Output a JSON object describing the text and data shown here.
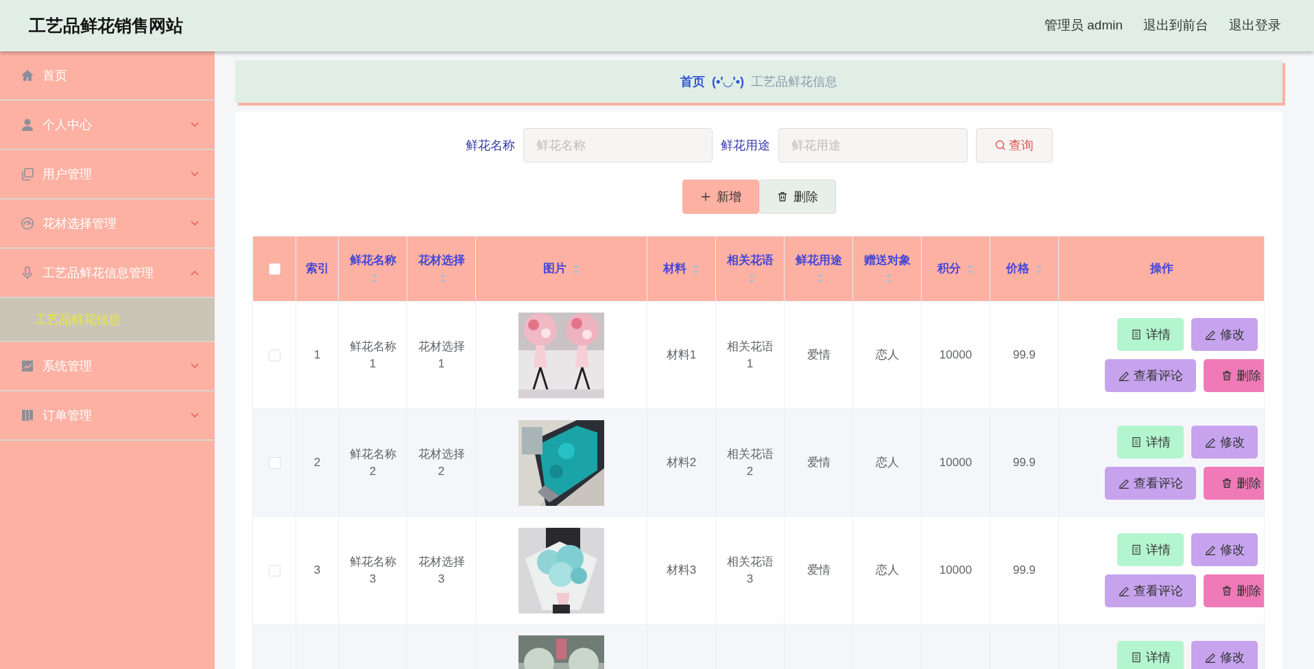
{
  "header": {
    "title": "工艺品鲜花销售网站",
    "links": [
      "管理员 admin",
      "退出到前台",
      "退出登录"
    ]
  },
  "sidebar": {
    "items": [
      {
        "label": "首页"
      },
      {
        "label": "个人中心",
        "expanded": false
      },
      {
        "label": "用户管理",
        "expanded": false
      },
      {
        "label": "花材选择管理",
        "expanded": false
      },
      {
        "label": "工艺品鲜花信息管理",
        "expanded": true,
        "children": [
          {
            "label": "工艺品鲜花信息",
            "selected": true
          }
        ]
      },
      {
        "label": "系统管理",
        "expanded": false
      },
      {
        "label": "订单管理",
        "expanded": false
      }
    ]
  },
  "breadcrumb": {
    "home": "首页",
    "emoticon": "(•'◡'•)",
    "current": "工艺品鲜花信息"
  },
  "search": {
    "fields": [
      {
        "label": "鲜花名称",
        "placeholder": "鲜花名称"
      },
      {
        "label": "鲜花用途",
        "placeholder": "鲜花用途"
      }
    ],
    "button": "查询"
  },
  "toolbar": [
    {
      "label": "新增",
      "kind": "add"
    },
    {
      "label": "删除",
      "kind": "delete"
    }
  ],
  "table": {
    "select_all": {
      "checked": false
    },
    "columns": [
      {
        "label": "索引",
        "sortable": false
      },
      {
        "label": "鲜花名称",
        "sortable": true
      },
      {
        "label": "花材选择",
        "sortable": true
      },
      {
        "label": "图片",
        "sortable": true
      },
      {
        "label": "材料",
        "sortable": true
      },
      {
        "label": "相关花语",
        "sortable": true
      },
      {
        "label": "鲜花用途",
        "sortable": true
      },
      {
        "label": "赠送对象",
        "sortable": true
      },
      {
        "label": "积分",
        "sortable": true
      },
      {
        "label": "价格",
        "sortable": true
      },
      {
        "label": "操作",
        "sortable": false
      }
    ],
    "rows": [
      {
        "checked": false,
        "cells": [
          "1",
          "鲜花名称1",
          "花材选择1",
          {
            "kind": "picture"
          },
          "材料1",
          "相关花语1",
          "爱情",
          "恋人",
          "10000",
          "99.9"
        ],
        "actions": [
          {
            "label": "详情",
            "kind": "detail"
          },
          {
            "label": "修改",
            "kind": "edit"
          },
          {
            "label": "查看评论",
            "kind": "comments"
          },
          {
            "label": "删除",
            "kind": "delete"
          }
        ]
      },
      {
        "checked": false,
        "cells": [
          "2",
          "鲜花名称2",
          "花材选择2",
          {
            "kind": "picture"
          },
          "材料2",
          "相关花语2",
          "爱情",
          "恋人",
          "10000",
          "99.9"
        ],
        "actions": [
          {
            "label": "详情",
            "kind": "detail"
          },
          {
            "label": "修改",
            "kind": "edit"
          },
          {
            "label": "查看评论",
            "kind": "comments"
          },
          {
            "label": "删除",
            "kind": "delete"
          }
        ]
      },
      {
        "checked": false,
        "cells": [
          "3",
          "鲜花名称3",
          "花材选择3",
          {
            "kind": "picture"
          },
          "材料3",
          "相关花语3",
          "爱情",
          "恋人",
          "10000",
          "99.9"
        ],
        "actions": [
          {
            "label": "详情",
            "kind": "detail"
          },
          {
            "label": "修改",
            "kind": "edit"
          },
          {
            "label": "查看评论",
            "kind": "comments"
          },
          {
            "label": "删除",
            "kind": "delete"
          }
        ]
      },
      {
        "cells": [
          null,
          null,
          null,
          {
            "kind": "picture"
          },
          null,
          null,
          null,
          null,
          null,
          null
        ],
        "actions": [
          {
            "label": "详情",
            "kind": "detail"
          },
          {
            "label": "修改",
            "kind": "edit"
          }
        ]
      }
    ]
  }
}
